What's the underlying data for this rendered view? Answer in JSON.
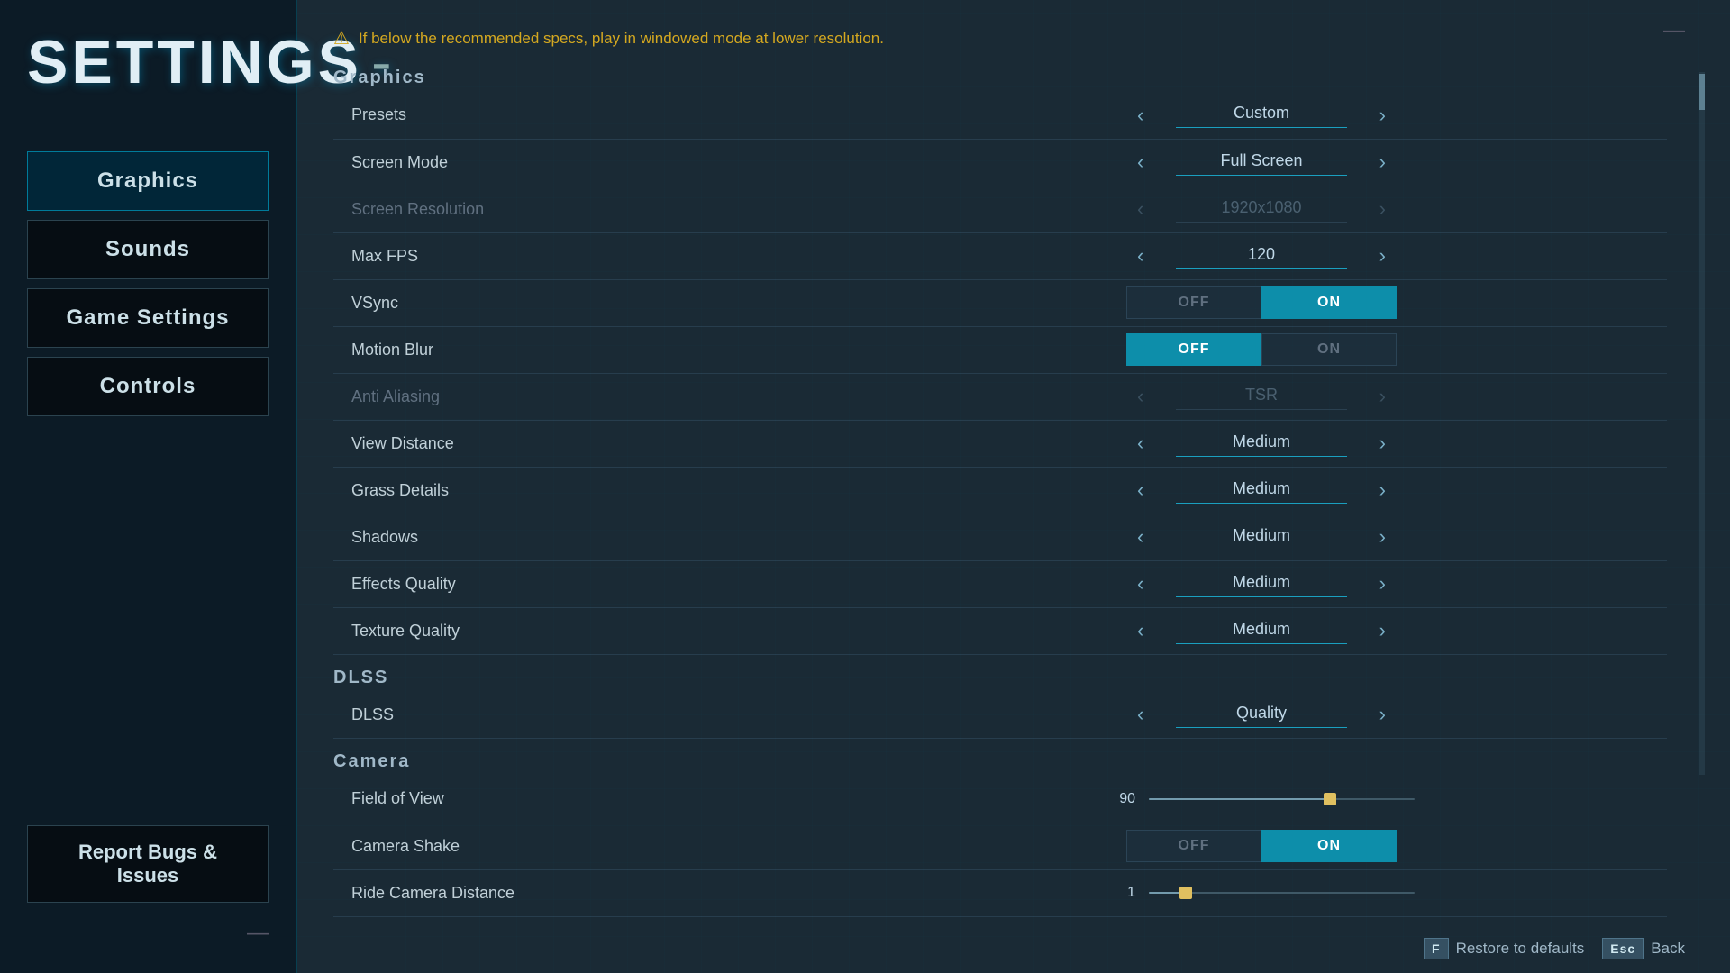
{
  "page": {
    "title": "SETTINGS",
    "title_dash": "-"
  },
  "sidebar": {
    "nav_items": [
      {
        "id": "graphics",
        "label": "Graphics",
        "active": true
      },
      {
        "id": "sounds",
        "label": "Sounds",
        "active": false
      },
      {
        "id": "game-settings",
        "label": "Game Settings",
        "active": false
      },
      {
        "id": "controls",
        "label": "Controls",
        "active": false
      }
    ],
    "report_label": "Report Bugs & Issues",
    "bottom_dash": "—"
  },
  "warning": {
    "icon": "⚠",
    "text": "If below the recommended specs, play in windowed mode at lower resolution."
  },
  "sections": {
    "graphics_label": "Graphics",
    "dlss_label": "DLSS",
    "camera_label": "Camera"
  },
  "settings": {
    "presets": {
      "label": "Presets",
      "value": "Custom",
      "dimmed": false
    },
    "screen_mode": {
      "label": "Screen Mode",
      "value": "Full Screen",
      "dimmed": false
    },
    "screen_resolution": {
      "label": "Screen Resolution",
      "value": "1920x1080",
      "dimmed": true
    },
    "max_fps": {
      "label": "Max FPS",
      "value": "120",
      "dimmed": false
    },
    "vsync": {
      "label": "VSync",
      "off": "OFF",
      "on": "ON",
      "active": "on"
    },
    "motion_blur": {
      "label": "Motion Blur",
      "off": "OFF",
      "on": "ON",
      "active": "off"
    },
    "anti_aliasing": {
      "label": "Anti Aliasing",
      "value": "TSR",
      "dimmed": true
    },
    "view_distance": {
      "label": "View Distance",
      "value": "Medium",
      "dimmed": false
    },
    "grass_details": {
      "label": "Grass Details",
      "value": "Medium",
      "dimmed": false
    },
    "shadows": {
      "label": "Shadows",
      "value": "Medium",
      "dimmed": false
    },
    "effects_quality": {
      "label": "Effects Quality",
      "value": "Medium",
      "dimmed": false
    },
    "texture_quality": {
      "label": "Texture Quality",
      "value": "Medium",
      "dimmed": false
    },
    "dlss": {
      "label": "DLSS",
      "value": "Quality",
      "dimmed": false
    },
    "field_of_view": {
      "label": "Field of View",
      "value": "90",
      "slider_pct": 68
    },
    "camera_shake": {
      "label": "Camera Shake",
      "off": "OFF",
      "on": "ON",
      "active": "on"
    },
    "ride_camera_distance": {
      "label": "Ride Camera Distance",
      "value": "1",
      "slider_pct": 14
    }
  },
  "footer": {
    "restore_key": "F",
    "restore_label": "Restore to defaults",
    "back_key": "Esc",
    "back_label": "Back"
  }
}
